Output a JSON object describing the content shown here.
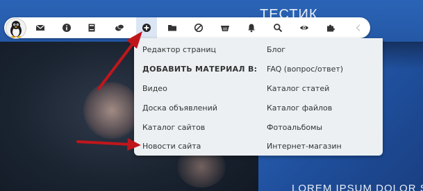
{
  "site": {
    "title": "ТЕСТИК",
    "tagline": "LOREM IPSUM DOLOR SIT"
  },
  "toolbar": {
    "avatar_icon": "tux-penguin-icon",
    "buttons": [
      {
        "name": "mail-icon"
      },
      {
        "name": "info-circle-icon"
      },
      {
        "name": "notebook-icon"
      },
      {
        "name": "chat-icon"
      },
      {
        "name": "add-circle-icon",
        "active": true
      },
      {
        "name": "folder-icon"
      },
      {
        "name": "ban-icon"
      },
      {
        "name": "basket-icon"
      },
      {
        "name": "bell-icon"
      },
      {
        "name": "search-icon"
      },
      {
        "name": "eye-icon"
      },
      {
        "name": "puzzle-icon"
      },
      {
        "name": "chevron-left-icon",
        "disabled": true
      }
    ]
  },
  "menu": {
    "left": {
      "page_editor": "Редактор страниц",
      "add_material_header": "ДОБАВИТЬ МАТЕРИАЛ В:",
      "video": "Видео",
      "board": "Доска объявлений",
      "site_catalog": "Каталог сайтов",
      "site_news": "Новости сайта"
    },
    "right": {
      "blog": "Блог",
      "faq": "FAQ (вопрос/ответ)",
      "articles": "Каталог статей",
      "files": "Каталог файлов",
      "photos": "Фотоальбомы",
      "shop": "Интернет-магазин"
    }
  },
  "colors": {
    "annotation_arrow": "#c0161b",
    "active_button_bg": "#dbe5f4",
    "menu_bg": "#ecf0f3"
  }
}
